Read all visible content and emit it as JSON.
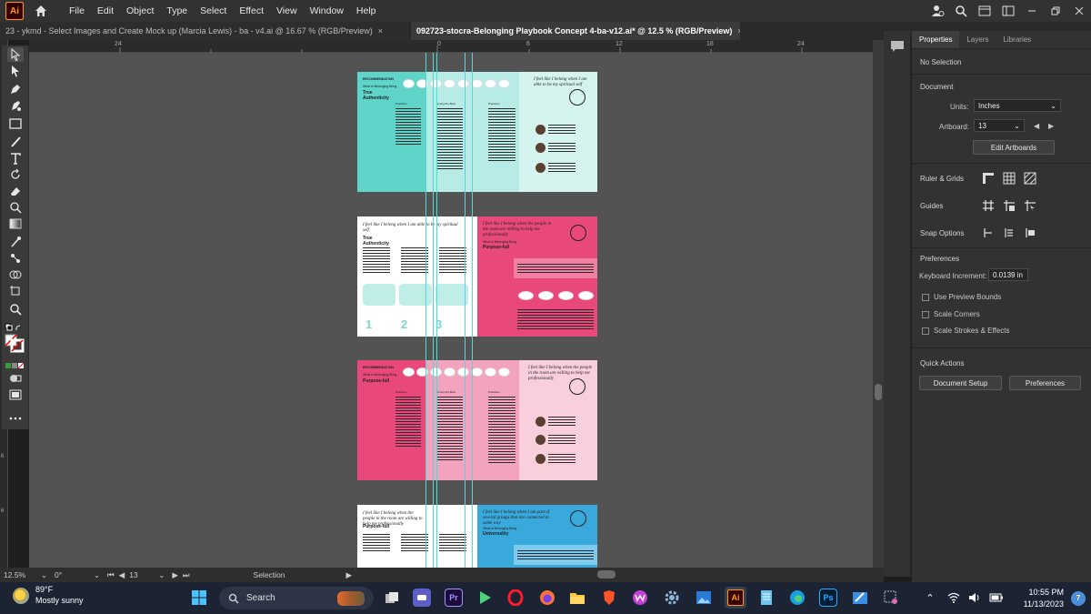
{
  "app": {
    "logo_text": "Ai",
    "menu": [
      "File",
      "Edit",
      "Object",
      "Type",
      "Select",
      "Effect",
      "View",
      "Window",
      "Help"
    ]
  },
  "tabs": [
    {
      "label": "23 - ykmd - Select Images and Create Mock up (Marcia Lewis) - ba - v4.ai @ 16.67 % (RGB/Preview)",
      "close": "×"
    },
    {
      "label": "092723-stocra-Belonging Playbook Concept 4-ba-v12.ai* @ 12.5 % (RGB/Preview)",
      "close": "×"
    }
  ],
  "ruler": {
    "h_ticks": [
      "24",
      "0",
      "6",
      "12",
      "18",
      "24"
    ],
    "v_ticks": [
      "6",
      "6"
    ]
  },
  "artboards": [
    {
      "left_color": "#5fd4c8",
      "mid_color": "#b7ece6",
      "right_color": "#d5f3ef",
      "eyebrow": "RECOMMENDATION",
      "subtitle": "What is Belonging Bring",
      "title": "True Authenticity",
      "col_heads": [
        "Practices",
        "Living the Brief",
        "Practices"
      ],
      "quote": "I feel like I belong when I am able to be my spiritual self"
    },
    {
      "left_color": "#ffffff",
      "right_color": "#e8497a",
      "left_headline": "I feel like I belong when I am able to be my spiritual self",
      "title": "True Authenticity",
      "right_headline": "I feel like I belong when the people in the room are willing to help me professionally",
      "right_subtitle": "What is Belonging Bring",
      "right_title": "Purpose-full",
      "nums": [
        "1",
        "2",
        "3"
      ]
    },
    {
      "left_color": "#e8497a",
      "mid_color": "#f3a3be",
      "right_color": "#f9cfdc",
      "eyebrow": "RECOMMENDATION",
      "subtitle": "What is Belonging Bring",
      "title": "Purpose-full",
      "col_heads": [
        "Practices",
        "Living the Brief",
        "Practices"
      ],
      "quote": "I feel like I belong when the people in the room are willing to help me professionally"
    },
    {
      "left_color": "#ffffff",
      "right_color": "#39a9dc",
      "left_headline": "I feel like I belong when the people in the room are willing to help me professionally",
      "title": "Purpose-full",
      "right_headline": "I feel like I belong when I am part of several groups that are connected in some way",
      "right_subtitle": "What is Belonging Bring",
      "right_title": "Universality"
    }
  ],
  "status": {
    "zoom": "12.5%",
    "rotation": "0°",
    "artboard": "13",
    "tool": "Selection"
  },
  "panel": {
    "tabs": [
      "Properties",
      "Layers",
      "Libraries"
    ],
    "selection": "No Selection",
    "document": {
      "title": "Document",
      "units_label": "Units:",
      "units_value": "Inches",
      "artboard_label": "Artboard:",
      "artboard_value": "13",
      "edit_button": "Edit Artboards"
    },
    "ruler_grids": "Ruler & Grids",
    "guides": "Guides",
    "snap_options": "Snap Options",
    "preferences": {
      "title": "Preferences",
      "kb_label": "Keyboard Increment:",
      "kb_value": "0.0139 in",
      "checks": [
        "Use Preview Bounds",
        "Scale Corners",
        "Scale Strokes & Effects"
      ]
    },
    "quick_actions": {
      "title": "Quick Actions",
      "doc_setup": "Document Setup",
      "prefs": "Preferences"
    }
  },
  "taskbar": {
    "temp": "89°F",
    "weather": "Mostly sunny",
    "search": "Search",
    "time": "10:55 PM",
    "date": "11/13/2023",
    "notif": "7",
    "premiere": "Pr",
    "illustrator": "Ai",
    "photoshop": "Ps"
  }
}
